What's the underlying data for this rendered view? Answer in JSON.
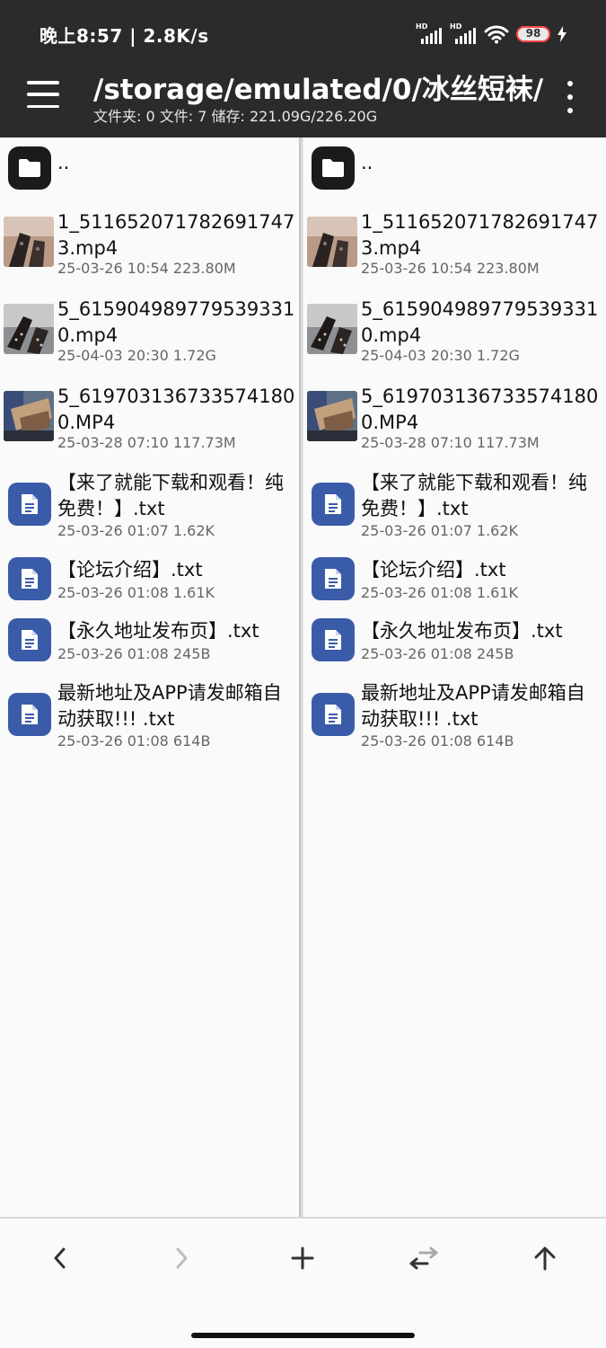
{
  "status_bar": {
    "time": "晚上8:57 | 2.8K/s",
    "signal1_label": "HD",
    "signal2_label": "HD",
    "battery": "98"
  },
  "header": {
    "path": "/storage/emulated/0/冰丝短袜/",
    "summary": "文件夹: 0  文件: 7  储存: 221.09G/226.20G"
  },
  "panes": [
    {
      "parent_label": "..",
      "files": [
        {
          "name": "1_5116520717826917473.mp4",
          "meta": "25-03-26 10:54  223.80M",
          "type": "video",
          "thumb": "a"
        },
        {
          "name": "5_6159049897795393310.mp4",
          "meta": "25-04-03 20:30  1.72G",
          "type": "video",
          "thumb": "b"
        },
        {
          "name": "5_6197031367335741800.MP4",
          "meta": "25-03-28 07:10  117.73M",
          "type": "video",
          "thumb": "c"
        },
        {
          "name": "【来了就能下载和观看！纯免费！】.txt",
          "meta": "25-03-26 01:07  1.62K",
          "type": "text"
        },
        {
          "name": "【论坛介绍】.txt",
          "meta": "25-03-26 01:08  1.61K",
          "type": "text"
        },
        {
          "name": "【永久地址发布页】.txt",
          "meta": "25-03-26 01:08  245B",
          "type": "text"
        },
        {
          "name": "最新地址及APP请发邮箱自动获取!!! .txt",
          "meta": "25-03-26 01:08  614B",
          "type": "text"
        }
      ]
    },
    {
      "parent_label": "..",
      "files": [
        {
          "name": "1_5116520717826917473.mp4",
          "meta": "25-03-26 10:54  223.80M",
          "type": "video",
          "thumb": "a"
        },
        {
          "name": "5_6159049897795393310.mp4",
          "meta": "25-04-03 20:30  1.72G",
          "type": "video",
          "thumb": "b"
        },
        {
          "name": "5_6197031367335741800.MP4",
          "meta": "25-03-28 07:10  117.73M",
          "type": "video",
          "thumb": "c"
        },
        {
          "name": "【来了就能下载和观看！纯免费！】.txt",
          "meta": "25-03-26 01:07  1.62K",
          "type": "text"
        },
        {
          "name": "【论坛介绍】.txt",
          "meta": "25-03-26 01:08  1.61K",
          "type": "text"
        },
        {
          "name": "【永久地址发布页】.txt",
          "meta": "25-03-26 01:08  245B",
          "type": "text"
        },
        {
          "name": "最新地址及APP请发邮箱自动获取!!! .txt",
          "meta": "25-03-26 01:08  614B",
          "type": "text"
        }
      ]
    }
  ],
  "bottom_nav": {
    "items": [
      {
        "icon": "chevron-left-icon",
        "enabled": true
      },
      {
        "icon": "chevron-right-icon",
        "enabled": false
      },
      {
        "icon": "plus-icon",
        "enabled": true
      },
      {
        "icon": "swap-icon",
        "enabled": true
      },
      {
        "icon": "arrow-up-icon",
        "enabled": true
      }
    ]
  },
  "colors": {
    "header_bg": "#2b2b2b",
    "doc_icon_bg": "#3a5ca8",
    "folder_icon_bg": "#1b1b1b"
  }
}
